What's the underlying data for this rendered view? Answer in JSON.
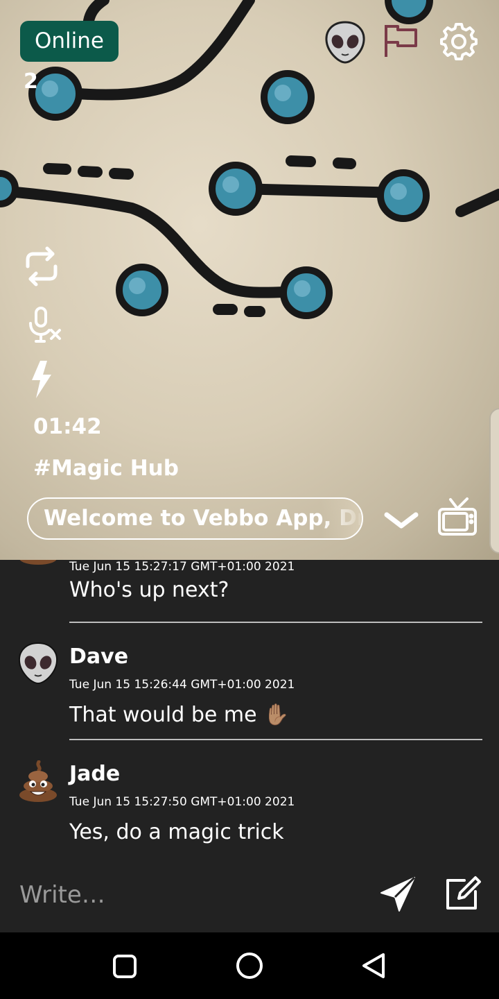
{
  "stream": {
    "status_label": "Online",
    "viewer_count": "2",
    "timer": "01:42",
    "channel": "#Magic Hub",
    "welcome_text": "Welcome to Vebbo App, Drop by and say hi"
  },
  "icons": {
    "avatar": "alien-icon",
    "report": "flag-icon",
    "settings": "gear-icon",
    "switch_camera": "rotate-camera-icon",
    "mute": "mic-off-icon",
    "flash": "flash-icon",
    "collapse": "chevron-down-icon",
    "tv": "tv-icon",
    "send": "send-icon",
    "compose": "edit-icon"
  },
  "messages": [
    {
      "name": "",
      "time": "Tue Jun 15 15:27:17 GMT+01:00 2021",
      "text": "Who's up next?",
      "avatar": "poop-emoji-avatar"
    },
    {
      "name": "Dave",
      "time": "Tue Jun 15 15:26:44 GMT+01:00 2021",
      "text": "That would be me ✋🏽",
      "avatar": "alien-avatar"
    },
    {
      "name": "Jade",
      "time": "Tue Jun 15 15:27:50 GMT+01:00 2021",
      "text": "Yes, do a magic trick",
      "avatar": "poop-emoji-avatar"
    }
  ],
  "composer": {
    "placeholder": "Write…"
  },
  "colors": {
    "status_green": "#0c5a4a",
    "flag_color": "#7a3a48",
    "chat_background": "#222222",
    "separator": "#bdbdbd"
  }
}
